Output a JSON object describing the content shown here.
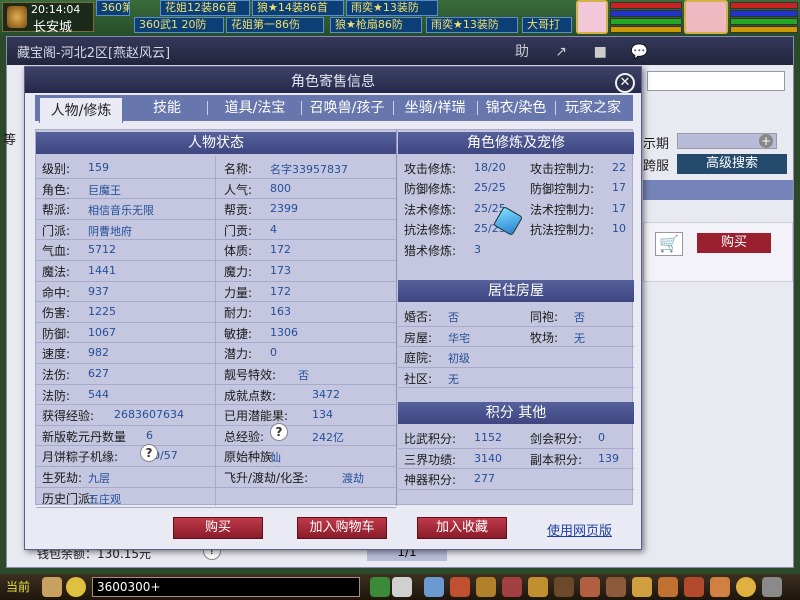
{
  "game": {
    "clock_time": "20:14:04",
    "city": "长安城",
    "banners": [
      "360第一打防F",
      "花姐12装86首",
      "狼★14装86首",
      "雨奕★13装防",
      "360武1 20防",
      "花姐第一86伤",
      "狼★枪扇86防",
      "雨奕★13装防",
      "大哥打"
    ]
  },
  "market": {
    "title": "藏宝阁-河北2区[燕赵风云]",
    "tools": [
      "助",
      "↗",
      "■",
      "💬"
    ],
    "notif_count": "1",
    "cc_logo": "CC直播",
    "price_period_label": "示期",
    "server_label": "跨服",
    "adv_search": "高级搜索",
    "buy_label": "购买",
    "wallet": "钱包余额：130.15元",
    "pager": "1/1",
    "left_mark": "等"
  },
  "dialog": {
    "title": "角色寄售信息",
    "tabs": [
      "人物/修炼",
      "技能",
      "道具/法宝",
      "召唤兽/孩子",
      "坐骑/祥瑞",
      "锦衣/染色",
      "玩家之家"
    ],
    "status": {
      "header": "人物状态",
      "rows": [
        {
          "l1": "级别:",
          "v1": "159",
          "l2": "名称:",
          "v2": "名字33957837"
        },
        {
          "l1": "角色:",
          "v1": "巨魔王",
          "l2": "人气:",
          "v2": "800"
        },
        {
          "l1": "帮派:",
          "v1": "相信音乐无限",
          "l2": "帮贡:",
          "v2": "2399"
        },
        {
          "l1": "门派:",
          "v1": "阴曹地府",
          "l2": "门贡:",
          "v2": "4"
        },
        {
          "l1": "气血:",
          "v1": "5712",
          "l2": "体质:",
          "v2": "172"
        },
        {
          "l1": "魔法:",
          "v1": "1441",
          "l2": "魔力:",
          "v2": "173"
        },
        {
          "l1": "命中:",
          "v1": "937",
          "l2": "力量:",
          "v2": "172"
        },
        {
          "l1": "伤害:",
          "v1": "1225",
          "l2": "耐力:",
          "v2": "163"
        },
        {
          "l1": "防御:",
          "v1": "1067",
          "l2": "敏捷:",
          "v2": "1306"
        },
        {
          "l1": "速度:",
          "v1": "982",
          "l2": "潜力:",
          "v2": "0"
        },
        {
          "l1": "法伤:",
          "v1": "627",
          "l2": "靓号特效:",
          "v2": "否"
        },
        {
          "l1": "法防:",
          "v1": "544",
          "l2": "成就点数:",
          "v2": "3472"
        },
        {
          "l1": "获得经验:",
          "v1": "2683607634",
          "l2": "已用潜能果:",
          "v2": "134"
        },
        {
          "l1": "新版乾元丹数量",
          "v1": "6",
          "l2": "总经验:",
          "v2": "242亿"
        },
        {
          "l1": "月饼粽子机缘:",
          "v1": "20/57",
          "l2": "原始种族:",
          "v2": "仙"
        },
        {
          "l1": "生死劫:",
          "v1": "九层",
          "l2": "飞升/渡劫/化圣:",
          "v2": "渡劫"
        },
        {
          "l1": "历史门派:",
          "v1": "五庄观",
          "l2": "",
          "v2": ""
        }
      ]
    },
    "cultivation": {
      "header": "角色修炼及宠修",
      "rows": [
        {
          "l1": "攻击修炼:",
          "v1": "18/20",
          "l2": "攻击控制力:",
          "v2": "22"
        },
        {
          "l1": "防御修炼:",
          "v1": "25/25",
          "l2": "防御控制力:",
          "v2": "17"
        },
        {
          "l1": "法术修炼:",
          "v1": "25/25",
          "l2": "法术控制力:",
          "v2": "17"
        },
        {
          "l1": "抗法修炼:",
          "v1": "25/25",
          "l2": "抗法控制力:",
          "v2": "10"
        },
        {
          "l1": "猎术修炼:",
          "v1": "3",
          "l2": "",
          "v2": ""
        }
      ]
    },
    "housing": {
      "header": "居住房屋",
      "rows": [
        {
          "l1": "婚否:",
          "v1": "否",
          "l2": "同袍:",
          "v2": "否"
        },
        {
          "l1": "房屋:",
          "v1": "华宅",
          "l2": "牧场:",
          "v2": "无"
        },
        {
          "l1": "庭院:",
          "v1": "初级",
          "l2": "",
          "v2": ""
        },
        {
          "l1": "社区:",
          "v1": "无",
          "l2": "",
          "v2": ""
        }
      ]
    },
    "points": {
      "header": "积分 其他",
      "rows": [
        {
          "l1": "比武积分:",
          "v1": "1152",
          "l2": "剑会积分:",
          "v2": "0"
        },
        {
          "l1": "三界功绩:",
          "v1": "3140",
          "l2": "副本积分:",
          "v2": "139"
        },
        {
          "l1": "神器积分:",
          "v1": "277",
          "l2": "",
          "v2": ""
        }
      ]
    },
    "buttons": {
      "buy": "购买",
      "add_cart": "加入购物车",
      "add_fav": "加入收藏",
      "web_version": "使用网页版"
    }
  },
  "bottom": {
    "current": "当前",
    "chat_text": "3600300+"
  },
  "colors": {
    "accent": "#6776ad",
    "button_red": "#9a2030",
    "value_blue": "#244f9a",
    "section_blue": "#4a5490"
  }
}
